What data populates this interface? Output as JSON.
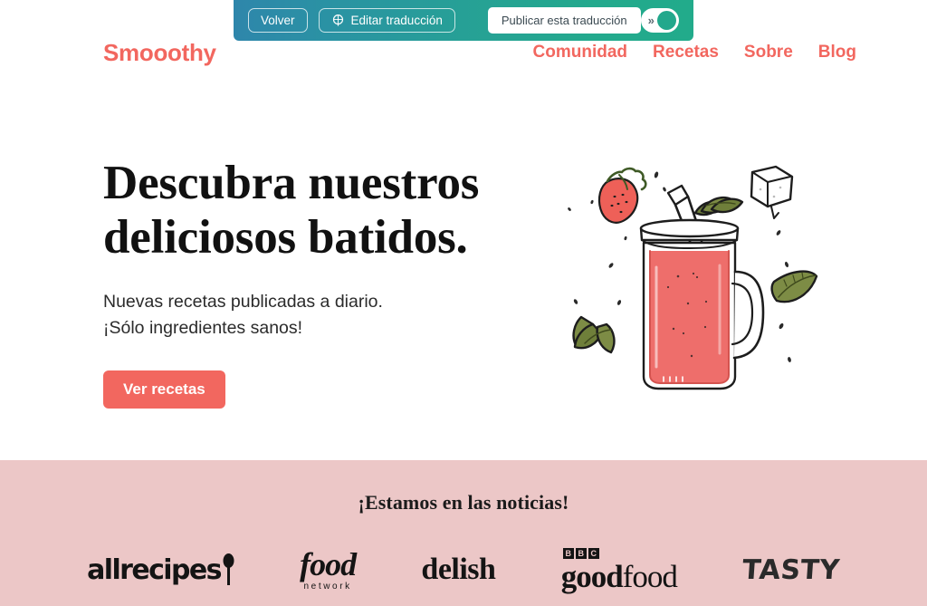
{
  "translation_toolbar": {
    "back_label": "Volver",
    "edit_label": "Editar traducción",
    "edit_icon": "globe-icon",
    "publish_label": "Publicar esta traducción",
    "toggle_chevrons": "»",
    "toggle_state": "on",
    "colors": {
      "gradient_start": "#2e86ab",
      "gradient_end": "#22ab8b",
      "toggle_knob": "#22a88c"
    }
  },
  "site_header": {
    "brand": "Smooothy",
    "nav": [
      {
        "label": "Comunidad"
      },
      {
        "label": "Recetas"
      },
      {
        "label": "Sobre"
      },
      {
        "label": "Blog"
      }
    ],
    "brand_color": "#f2675f"
  },
  "hero": {
    "heading": "Descubra nuestros deliciosos batidos.",
    "subtitle": "Nuevas recetas publicadas a diario.\n¡Sólo ingredientes sanos!",
    "cta_label": "Ver recetas",
    "cta_color": "#f2675f",
    "illustration": {
      "name": "smoothie-mason-jar-illustration",
      "elements": [
        "mason-jar",
        "straw",
        "strawberry",
        "ice-cube",
        "mint-leaves"
      ],
      "smoothie_color": "#ee6e6b"
    }
  },
  "press": {
    "title": "¡Estamos en las noticias!",
    "background_color": "#ecc7c7",
    "logos": [
      {
        "name": "allrecipes",
        "text": "allrecipes",
        "icon": "spoon-icon"
      },
      {
        "name": "food-network",
        "text": "food",
        "subtext": "network"
      },
      {
        "name": "delish",
        "text": "delish"
      },
      {
        "name": "bbc-goodfood",
        "badge": [
          "B",
          "B",
          "C"
        ],
        "text_bold": "good",
        "text_light": "food"
      },
      {
        "name": "tasty",
        "text": "TASTY"
      }
    ]
  }
}
